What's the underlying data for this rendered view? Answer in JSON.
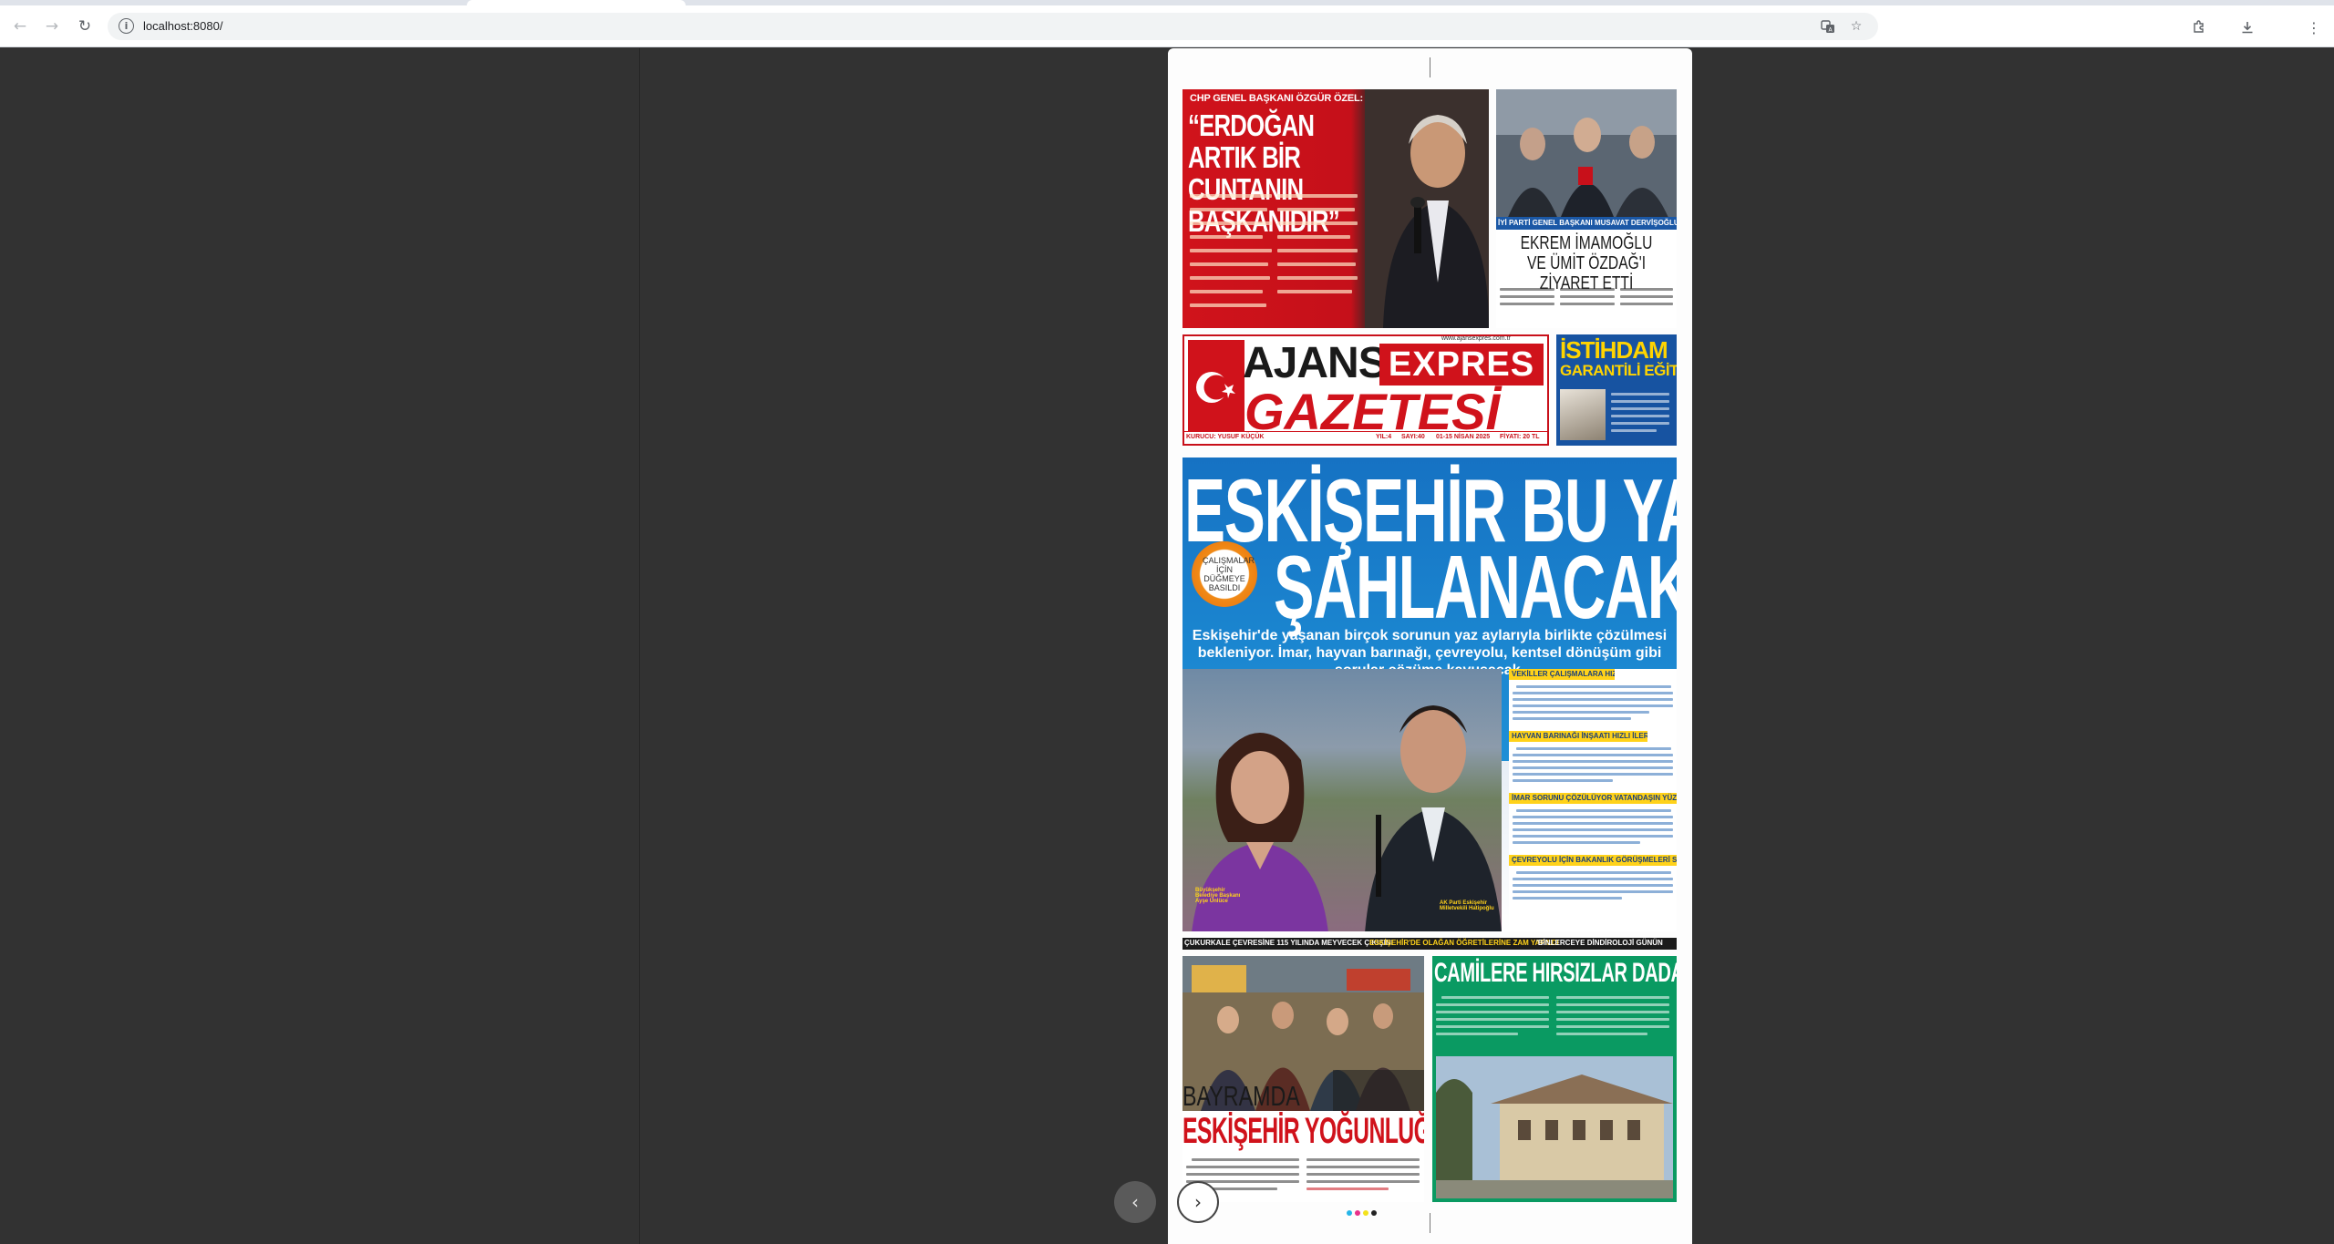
{
  "browser": {
    "url": "localhost:8080/",
    "icons": {
      "back": "arrow-left-icon",
      "forward": "arrow-right-icon",
      "reload": "reload-icon",
      "site_info": "info-icon",
      "translate": "translate-icon",
      "bookmark": "star-icon",
      "extensions": "puzzle-icon",
      "downloads": "download-icon",
      "menu": "kebab-menu-icon"
    }
  },
  "newspaper": {
    "story_top_left": {
      "kicker": "CHP GENEL BAŞKANI ÖZGÜR ÖZEL:",
      "headline": "“ERDOĞAN ARTIK BİR CUNTANIN BAŞKANIDIR”"
    },
    "story_top_right": {
      "caption": "İYİ PARTİ GENEL BAŞKANI MUSAVAT DERVİŞOĞLU",
      "headline": "EKREM İMAMOĞLU VE ÜMİT ÖZDAĞ'I ZİYARET ETTİ"
    },
    "masthead": {
      "word1": "AJANS",
      "word2": "EXPRES",
      "word3": "GAZETESİ",
      "website": "www.ajansexpres.com.tr",
      "founder": "KURUCU: YUSUF KÜÇÜK",
      "year": "YIL:4",
      "issue": "SAYI:40",
      "date": "01-15 NİSAN 2025",
      "price": "FİYATI: 20 TL"
    },
    "istihdam": {
      "title": "İSTİHDAM",
      "subtitle": "GARANTİLİ EĞİTİM"
    },
    "main_story": {
      "headline_line1": "ESKİŞEHİR BU YAZ",
      "headline_line2": "ŞAHLANACAK!",
      "badge": "ÇALIŞMALAR İÇİN DÜĞMEYE BASILDI",
      "subtitle": "Eskişehir'de yaşanan birçok sorunun yaz aylarıyla birlikte çözülmesi bekleniyor. İmar, hayvan barınağı, çevreyolu, kentsel dönüşüm gibi sorular çözüme kavuşacak.",
      "subheads": [
        "VEKİLLER ÇALIŞMALARA HIZ VERDİ",
        "HAYVAN BARINAĞI İNŞAATI HIZLI İLERLİYOR",
        "İMAR SORUNU ÇÖZÜLÜYOR VATANDAŞIN YÜZÜ GÜLECEK",
        "ÇEVREYOLU İÇİN BAKANLIK GÖRÜŞMELERİ SÜRÜYOR"
      ],
      "photo_caption_left": "Büyükşehir Belediye Başkanı Ayşe Ünlüce",
      "photo_caption_right": "AK Parti Eskişehir Milletvekili Hatipoğlu"
    },
    "ticker": [
      "ÇUKURKALE ÇEVRESİNE 115 YILINDA MEYVECEK ÇIKIŞINI",
      "ESKİŞEHİR'DE OLAĞAN ÖĞRETİLERİNE ZAM YAPILDI",
      "'BİNLERCEYE DİNDİROLOJİ GÜNÜN"
    ],
    "story_bottom_left": {
      "kicker": "BAYRAMDA",
      "headline": "ESKİŞEHİR YOĞUNLUĞU"
    },
    "story_bottom_right": {
      "headline": "CAMİLERE HIRSIZLAR DADANDI"
    },
    "print_dot_colors": [
      "#27b5e8",
      "#e8318a",
      "#f3e21c",
      "#222222"
    ]
  },
  "viewer": {
    "prev_icon": "chevron-left-icon",
    "next_icon": "chevron-right-icon"
  }
}
